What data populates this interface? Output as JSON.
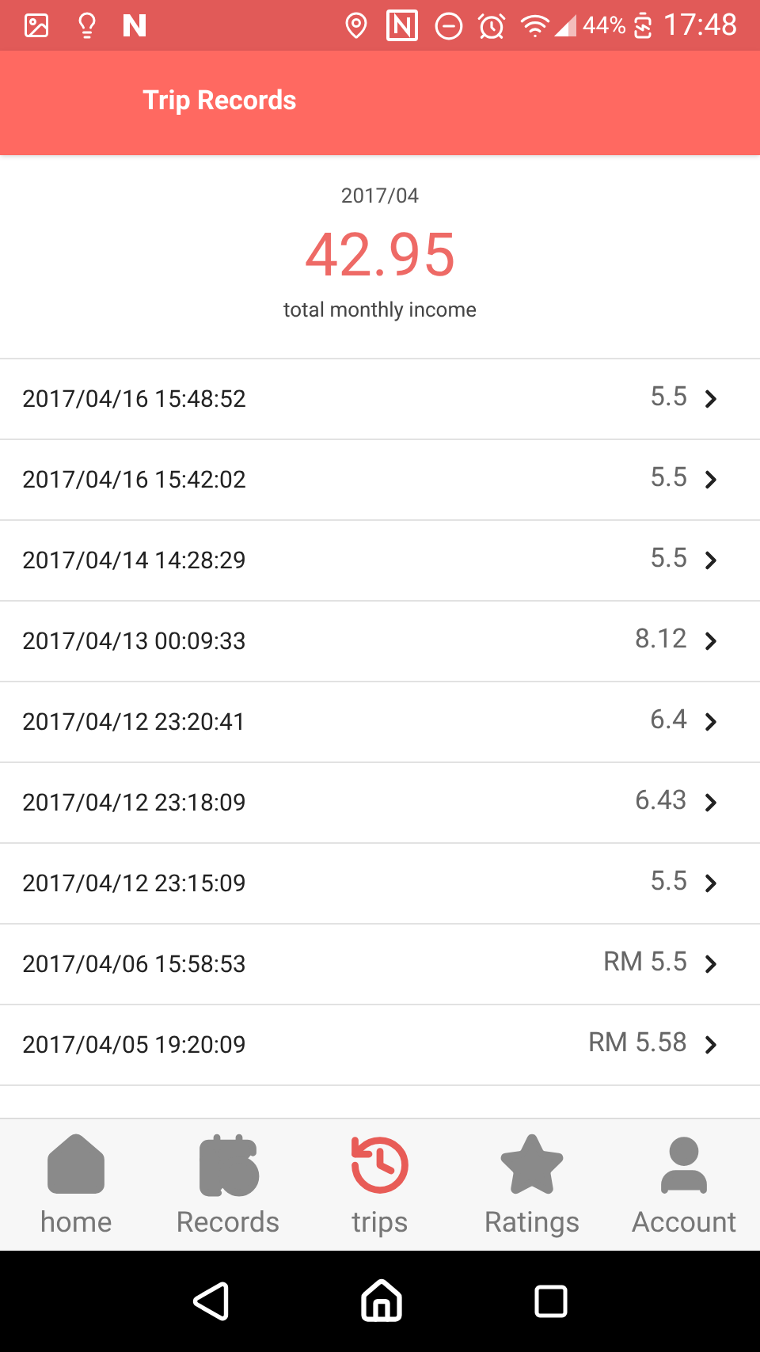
{
  "status_bar": {
    "battery": "44%",
    "time": "17:48"
  },
  "header": {
    "title": "Trip Records"
  },
  "summary": {
    "month": "2017/04",
    "total": "42.95",
    "caption": "total monthly income"
  },
  "trips": [
    {
      "datetime": "2017/04/16 15:48:52",
      "amount": "5.5"
    },
    {
      "datetime": "2017/04/16 15:42:02",
      "amount": "5.5"
    },
    {
      "datetime": "2017/04/14 14:28:29",
      "amount": "5.5"
    },
    {
      "datetime": "2017/04/13 00:09:33",
      "amount": "8.12"
    },
    {
      "datetime": "2017/04/12 23:20:41",
      "amount": "6.4"
    },
    {
      "datetime": "2017/04/12 23:18:09",
      "amount": "6.43"
    },
    {
      "datetime": "2017/04/12 23:15:09",
      "amount": "5.5"
    },
    {
      "datetime": "2017/04/06 15:58:53",
      "amount": "RM 5.5"
    },
    {
      "datetime": "2017/04/05 19:20:09",
      "amount": "RM 5.58"
    }
  ],
  "bottom_nav": [
    {
      "kind": "home",
      "label": "home",
      "selected": false
    },
    {
      "kind": "records",
      "label": "Records",
      "selected": false
    },
    {
      "kind": "trips",
      "label": "trips",
      "selected": true
    },
    {
      "kind": "ratings",
      "label": "Ratings",
      "selected": false
    },
    {
      "kind": "account",
      "label": "Account",
      "selected": false
    }
  ]
}
